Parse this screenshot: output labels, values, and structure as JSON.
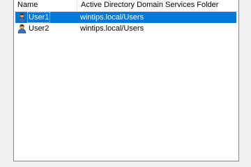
{
  "list": {
    "columns": [
      {
        "label": "Name"
      },
      {
        "label": "Active Directory Domain Services Folder"
      }
    ],
    "rows": [
      {
        "name": "User1",
        "folder": "wintips.local/Users",
        "selected": true,
        "icon": "user-icon"
      },
      {
        "name": "User2",
        "folder": "wintips.local/Users",
        "selected": false,
        "icon": "user-icon"
      }
    ]
  },
  "colors": {
    "selection": "#0078d7",
    "border": "#828790"
  }
}
